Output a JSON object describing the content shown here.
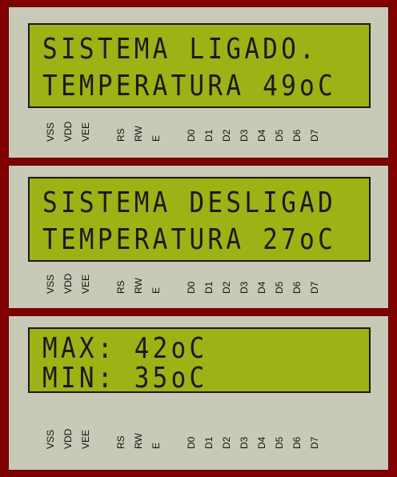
{
  "colors": {
    "background": "#800000",
    "panel": "#c9c9b8",
    "lcd_screen": "#9db214",
    "lcd_text": "#1a1a1a"
  },
  "displays": [
    {
      "line1": "SISTEMA LIGADO.",
      "line2": "TEMPERATURA 49oC",
      "pins": [
        "VSS",
        "VDD",
        "VEE",
        "RS",
        "RW",
        "E",
        "D0",
        "D1",
        "D2",
        "D3",
        "D4",
        "D5",
        "D6",
        "D7"
      ]
    },
    {
      "line1": "SISTEMA DESLIGAD",
      "line2": "TEMPERATURA 27oC",
      "pins": [
        "VSS",
        "VDD",
        "VEE",
        "RS",
        "RW",
        "E",
        "D0",
        "D1",
        "D2",
        "D3",
        "D4",
        "D5",
        "D6",
        "D7"
      ]
    },
    {
      "line1": "MAX: 42oC",
      "line2": "MIN: 35oC",
      "pins": [
        "VSS",
        "VDD",
        "VEE",
        "RS",
        "RW",
        "E",
        "D0",
        "D1",
        "D2",
        "D3",
        "D4",
        "D5",
        "D6",
        "D7"
      ]
    }
  ]
}
